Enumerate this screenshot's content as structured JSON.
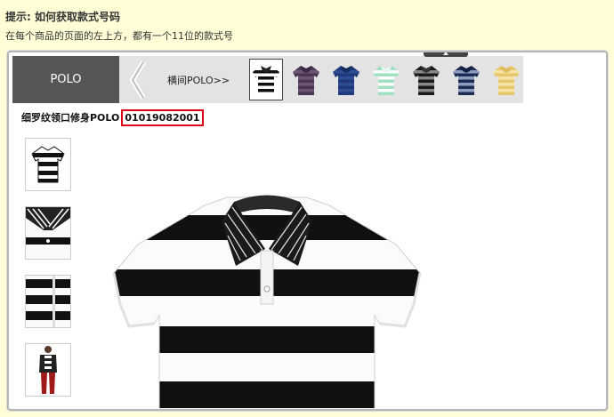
{
  "hint": {
    "title": "提示: 如何获取款式号码",
    "text": "在每个商品的页面的左上方，都有一个11位的款式号"
  },
  "nav": {
    "category": "POLO",
    "collection_link": "横间POLO>>"
  },
  "swatches": [
    {
      "name": "black-white-stripe",
      "body": "#ffffff",
      "stripe": "#111111",
      "collar": "#222222"
    },
    {
      "name": "purple",
      "body": "#4a3553",
      "stripe": "#6b5675",
      "collar": "#3a2742"
    },
    {
      "name": "blue",
      "body": "#1e3a7a",
      "stripe": "#2d4c91",
      "collar": "#132a5c"
    },
    {
      "name": "mint-stripe",
      "body": "#9fe0c2",
      "stripe": "#ffffff",
      "collar": "#e8f7ef"
    },
    {
      "name": "black-grey-stripe",
      "body": "#1a1a1a",
      "stripe": "#888888",
      "collar": "#333333"
    },
    {
      "name": "navy-stripe",
      "body": "#1d2c52",
      "stripe": "#8e9cc0",
      "collar": "#13203f"
    },
    {
      "name": "yellow-stripe",
      "body": "#e8c66a",
      "stripe": "#f5e4a8",
      "collar": "#e0bc5c"
    }
  ],
  "product": {
    "title": "细罗纹领口修身POLO",
    "code": "01019082001"
  },
  "accent": "#e0001a"
}
